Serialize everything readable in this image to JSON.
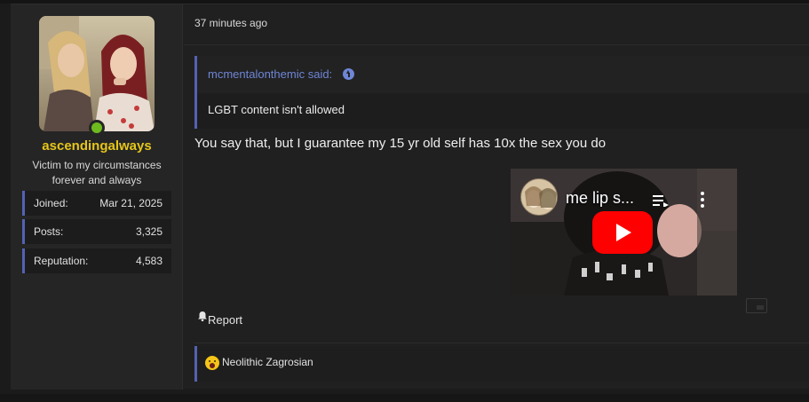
{
  "user": {
    "username": "ascendingalways",
    "title": "Victim to my circumstances forever and always",
    "online": true,
    "stats": [
      {
        "label": "Joined:",
        "value": "Mar 21, 2025"
      },
      {
        "label": "Posts:",
        "value": "3,325"
      },
      {
        "label": "Reputation:",
        "value": "4,583"
      }
    ]
  },
  "post": {
    "timestamp": "37 minutes ago",
    "quote": {
      "author": "mcmentalonthemic said:",
      "body": "LGBT content isn't allowed"
    },
    "message": "You say that, but I guarantee my 15 yr old self has 10x the sex you do",
    "video": {
      "title": "me lip s...",
      "icons": [
        "queue-icon",
        "more-options-icon",
        "play-icon"
      ]
    },
    "report_label": "Report",
    "reactions": {
      "emoji": "astonished-face-icon",
      "text": "Neolithic Zagrosian"
    }
  },
  "colors": {
    "accent": "#5462b3",
    "username": "#e6c619",
    "link": "#6e86d6",
    "online": "#6dbb1f",
    "youtube_red": "#ff0000"
  }
}
